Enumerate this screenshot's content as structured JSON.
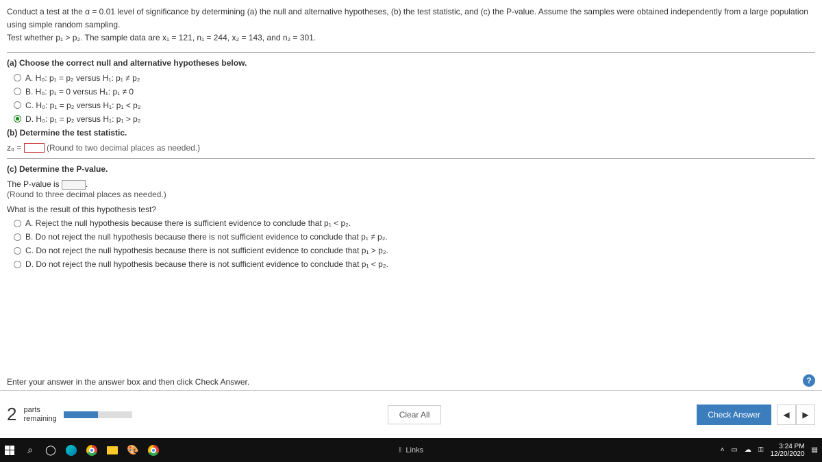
{
  "question": {
    "intro": "Conduct a test at the α = 0.01 level of significance by determining (a) the null and alternative hypotheses, (b) the test statistic, and (c) the P-value. Assume the samples were obtained independently from a large population using simple random sampling.",
    "line2": "Test whether p₁ > p₂. The sample data are x₁ = 121, n₁ = 244, x₂ = 143, and n₂ = 301."
  },
  "partA": {
    "heading": "(a) Choose the correct null and alternative hypotheses below.",
    "opts": {
      "a": "A.  H₀: p₁ = p₂ versus H₁: p₁ ≠ p₂",
      "b": "B.  H₀: p₁ = 0 versus H₁: p₁ ≠ 0",
      "c": "C.  H₀: p₁ = p₂ versus H₁: p₁ < p₂",
      "d": "D.  H₀: p₁ = p₂ versus H₁: p₁ > p₂"
    }
  },
  "partB": {
    "heading": "(b) Determine the test statistic.",
    "prefix": "z₀ = ",
    "note": " (Round to two decimal places as needed.)"
  },
  "partC": {
    "heading": "(c) Determine the P-value.",
    "pvalue_prefix": "The P-value is ",
    "note": "(Round to three decimal places as needed.)",
    "result_q": "What is the result of this hypothesis test?",
    "opts": {
      "a": "A.  Reject the null hypothesis because there is sufficient evidence to conclude that p₁ < p₂.",
      "b": "B.  Do not reject the null hypothesis because there is not sufficient evidence to conclude that p₁ ≠ p₂.",
      "c": "C.  Do not reject the null hypothesis because there is not sufficient evidence to conclude that p₁ > p₂.",
      "d": "D.  Do not reject the null hypothesis because there is not sufficient evidence to conclude that p₁ < p₂."
    }
  },
  "prompt": "Enter your answer in the answer box and then click Check Answer.",
  "footer": {
    "num": "2",
    "parts1": "parts",
    "parts2": "remaining",
    "clear": "Clear All",
    "check": "Check Answer",
    "help": "?"
  },
  "taskbar": {
    "links": "Links",
    "time": "3:24 PM",
    "date": "12/20/2020"
  }
}
